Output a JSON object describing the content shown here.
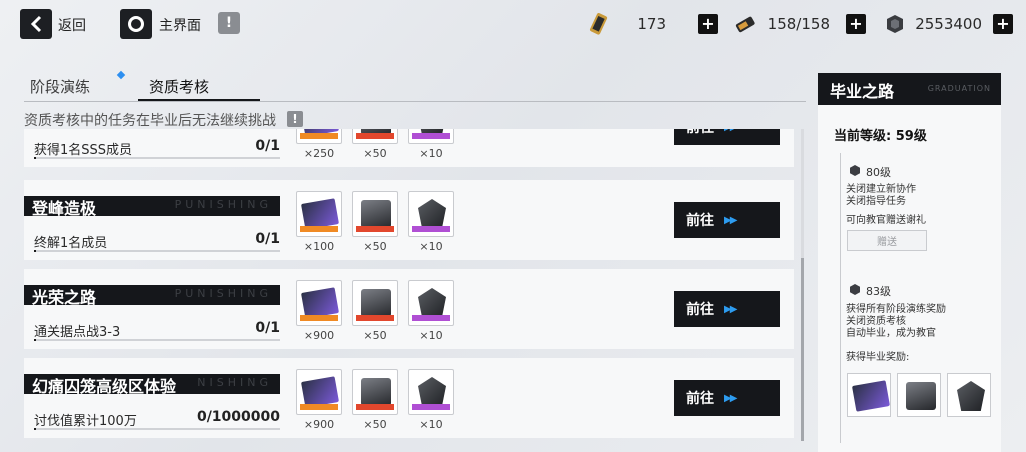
{
  "topbar": {
    "back_label": "返回",
    "home_label": "主界面",
    "info_icon": "!",
    "resources": [
      {
        "icon": "stamina-card-icon",
        "value": "173",
        "plus": "+"
      },
      {
        "icon": "battery-icon",
        "value": "158/158",
        "plus": "+"
      },
      {
        "icon": "cog-coin-icon",
        "value": "2553400",
        "plus": "+"
      }
    ]
  },
  "tabs": [
    {
      "label": "阶段演练",
      "active": false
    },
    {
      "label": "资质考核",
      "active": true
    }
  ],
  "notice": {
    "text": "资质考核中的任务在毕业后无法继续挑战",
    "icon": "!"
  },
  "tasks": [
    {
      "title": "",
      "watermark": "",
      "desc": "获得1名SSS成员",
      "progress": "0/1",
      "rewards": [
        "×250",
        "×50",
        "×10"
      ],
      "go_label": "前往",
      "go_arrow": "▶▶"
    },
    {
      "title": "登峰造极",
      "watermark": "PUNISHING",
      "desc": "终解1名成员",
      "progress": "0/1",
      "rewards": [
        "×100",
        "×50",
        "×10"
      ],
      "go_label": "前往",
      "go_arrow": "▶▶"
    },
    {
      "title": "光荣之路",
      "watermark": "PUNISHING",
      "desc": "通关据点战3-3",
      "progress": "0/1",
      "rewards": [
        "×900",
        "×50",
        "×10"
      ],
      "go_label": "前往",
      "go_arrow": "▶▶"
    },
    {
      "title": "幻痛囚笼高级区体验",
      "watermark": "NISHING",
      "desc": "讨伐值累计100万",
      "progress": "0/1000000",
      "rewards": [
        "×900",
        "×50",
        "×10"
      ],
      "go_label": "前往",
      "go_arrow": "▶▶"
    }
  ],
  "panel": {
    "title": "毕业之路",
    "subtitle": "GRADUATION",
    "current_level": "当前等级: 59级",
    "milestones": [
      {
        "name": "80级",
        "lines": [
          "关闭建立新协作",
          "关闭指导任务"
        ],
        "extra": "可向教官赠送谢礼",
        "button": "赠送"
      },
      {
        "name": "83级",
        "lines": [
          "获得所有阶段演练奖励",
          "关闭资质考核",
          "自动毕业，成为教官"
        ],
        "reward_label": "获得毕业奖励:"
      }
    ]
  },
  "colors": {
    "dark": "#15171b",
    "accent_blue": "#2d9cf0",
    "ticket_orange": "#f08a24",
    "chip_red": "#e2472d",
    "crystal_purple": "#b04fd4"
  }
}
